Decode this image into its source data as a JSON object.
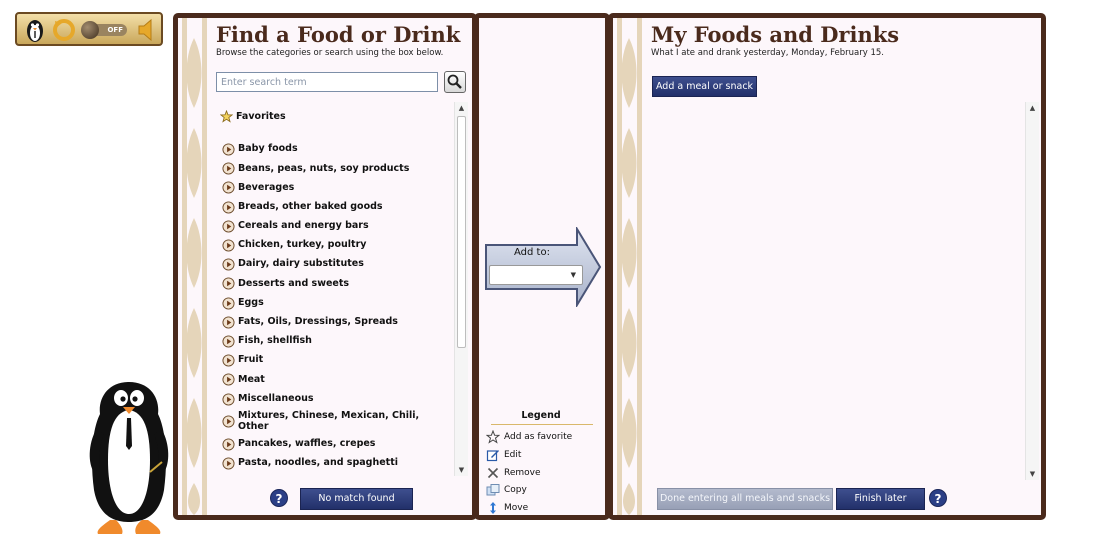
{
  "toolbar": {
    "toggle_label": "OFF"
  },
  "left": {
    "title": "Find a Food or Drink",
    "subtitle": "Browse the categories or search using the box below.",
    "search_placeholder": "Enter search term",
    "favorites_label": "Favorites",
    "categories": [
      "Baby foods",
      "Beans, peas, nuts, soy products",
      "Beverages",
      "Breads, other baked goods",
      "Cereals and energy bars",
      "Chicken, turkey, poultry",
      "Dairy, dairy substitutes",
      "Desserts and sweets",
      "Eggs",
      "Fats, Oils, Dressings, Spreads",
      "Fish, shellfish",
      "Fruit",
      "Meat",
      "Miscellaneous",
      "Mixtures, Chinese, Mexican, Chili, Other",
      "Pancakes, waffles, crepes",
      "Pasta, noodles, and spaghetti"
    ],
    "help_label": "?",
    "no_match_label": "No match found"
  },
  "middle": {
    "add_to_label": "Add to:",
    "add_to_value": "",
    "legend_title": "Legend",
    "legend": {
      "favorite": "Add as favorite",
      "edit": "Edit",
      "remove": "Remove",
      "copy": "Copy",
      "move": "Move"
    }
  },
  "right": {
    "title": "My Foods and Drinks",
    "subtitle": "What I ate and drank yesterday, Monday, February 15.",
    "add_meal_label": "Add a meal or snack",
    "done_label": "Done entering all meals and snacks",
    "finish_later_label": "Finish later",
    "help_label": "?"
  },
  "colors": {
    "panel_border": "#4a2a1c",
    "button_navy": "#22306a",
    "panel_bg": "#fdf7fb",
    "toolbar_gold": "#e3c67f"
  },
  "icons": [
    "penguin-icon",
    "replay-icon",
    "sound-icon",
    "search-icon",
    "star-icon",
    "play-icon",
    "edit-icon",
    "remove-icon",
    "copy-icon",
    "move-icon",
    "help-icon"
  ]
}
